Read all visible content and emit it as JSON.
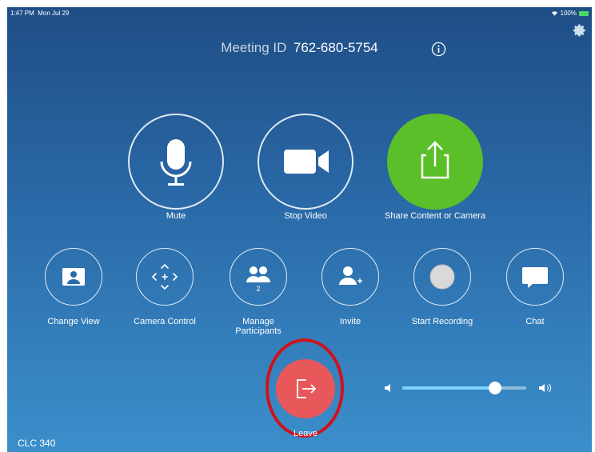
{
  "status": {
    "time": "1:47 PM",
    "date": "Mon Jul 29",
    "battery": "100%"
  },
  "meeting": {
    "id_label": "Meeting ID",
    "id_value": "762-680-5754"
  },
  "primary_actions": {
    "mute": "Mute",
    "stop_video": "Stop Video",
    "share": "Share Content or Camera"
  },
  "secondary_actions": {
    "change_view": "Change View",
    "camera_control": "Camera Control",
    "manage_participants_line1": "Manage",
    "manage_participants_line2": "Participants",
    "participant_count": "2",
    "invite": "Invite",
    "start_recording": "Start Recording",
    "chat": "Chat"
  },
  "leave": {
    "label": "Leave"
  },
  "volume": {
    "level": 0.75
  },
  "room_name": "CLC 340",
  "colors": {
    "share_green": "#5bbf29",
    "leave_red": "#e8575a",
    "annotation_ring": "#d0121b"
  }
}
